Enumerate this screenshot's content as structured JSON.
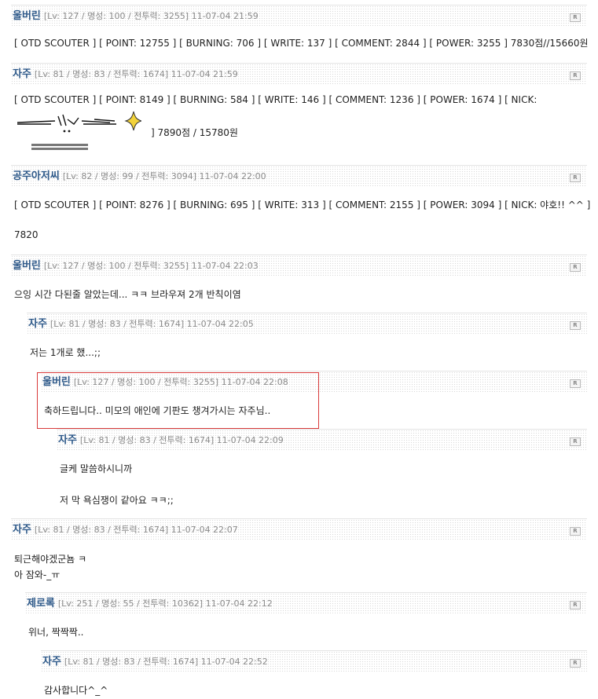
{
  "comments": [
    {
      "author": "울버린",
      "meta": "[Lv: 127 / 명성: 100 / 전투력: 3255]  11-07-04 21:59",
      "lines": [
        "[ OTD SCOUTER ] [ POINT: 12755 ] [ BURNING: 706 ] [ WRITE: 137 ] [ COMMENT: 2844 ] [ POWER: 3255 ] 7830점//15660원"
      ]
    },
    {
      "author": "자주",
      "meta": "[Lv: 81 / 명성: 83 / 전투력: 1674]  11-07-04 21:59",
      "lines": [
        "[ OTD SCOUTER ] [ POINT: 8149 ] [ BURNING: 584 ] [ WRITE: 146 ] [ COMMENT: 1236 ] [ POWER: 1674 ] [ NICK:",
        "] 7890점 / 15780원"
      ]
    },
    {
      "author": "공주아저씨",
      "meta": "[Lv: 82 / 명성: 99 / 전투력: 3094]  11-07-04 22:00",
      "lines": [
        "[ OTD SCOUTER ] [ POINT: 8276 ] [ BURNING: 695 ] [ WRITE: 313 ] [ COMMENT: 2155 ] [ POWER: 3094 ] [ NICK: 야호!! ^^ ]",
        "7820"
      ]
    },
    {
      "author": "울버린",
      "meta": "[Lv: 127 / 명성: 100 / 전투력: 3255]  11-07-04 22:03",
      "lines": [
        "으잉 시간 다된줄 알았는데... ㅋㅋ 브라우져 2개 반칙이염"
      ]
    },
    {
      "author": "자주",
      "meta": "[Lv: 81 / 명성: 83 / 전투력: 1674]  11-07-04 22:05",
      "lines": [
        "저는 1개로 했...;;"
      ]
    },
    {
      "author": "울버린",
      "meta": "[Lv: 127 / 명성: 100 / 전투력: 3255]  11-07-04 22:08",
      "lines": [
        "축하드립니다.. 미모의 애인에 기판도 챙겨가시는 자주님.."
      ]
    },
    {
      "author": "자주",
      "meta": "[Lv: 81 / 명성: 83 / 전투력: 1674]  11-07-04 22:09",
      "lines": [
        "글케 말씀하시니까",
        "저 막 욕심쟁이 같아요 ㅋㅋ;;"
      ]
    },
    {
      "author": "자주",
      "meta": "[Lv: 81 / 명성: 83 / 전투력: 1674]  11-07-04 22:07",
      "lines": [
        "퇴근해야겠군뇸 ㅋ\n아 잠와-_ㅠ"
      ]
    },
    {
      "author": "제로록",
      "meta": "[Lv: 251 / 명성: 55 / 전투력: 10362]  11-07-04 22:12",
      "lines": [
        "위너, 짝짝짝.."
      ]
    },
    {
      "author": "자주",
      "meta": "[Lv: 81 / 명성: 83 / 전투력: 1674]  11-07-04 22:52",
      "lines": [
        "감사합니다^_^"
      ]
    }
  ],
  "reply_icon_label": "R"
}
